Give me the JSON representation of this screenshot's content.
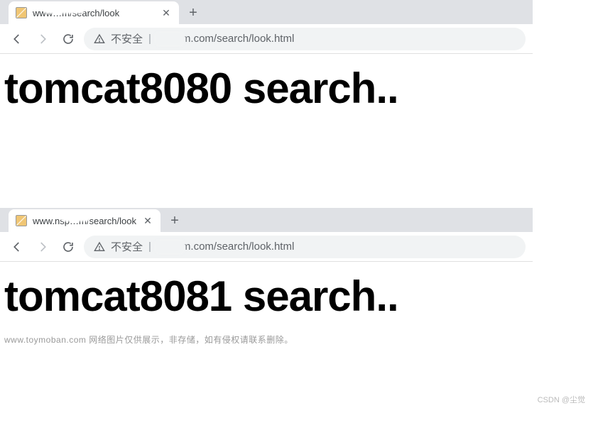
{
  "windows": [
    {
      "tab": {
        "title": "www…m/search/look",
        "close_label": "✕"
      },
      "new_tab_label": "+",
      "address": {
        "security_text": "不安全",
        "url_display": "crm.com/search/look.html"
      },
      "page_heading": "tomcat8080 search.."
    },
    {
      "tab": {
        "title": "www.nsp…m/search/look",
        "close_label": "✕"
      },
      "new_tab_label": "+",
      "address": {
        "security_text": "不安全",
        "url_display": "crm.com/search/look.html"
      },
      "page_heading": "tomcat8081 search.."
    }
  ],
  "footer_caption": "www.toymoban.com  网络图片仅供展示，非存储，如有侵权请联系删除。",
  "watermark": "CSDN @尘觉"
}
